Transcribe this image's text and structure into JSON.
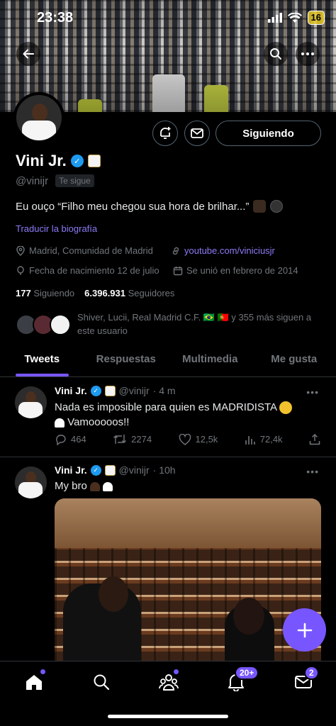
{
  "status_bar": {
    "time": "23:38",
    "battery": "16"
  },
  "profile": {
    "name": "Vini Jr.",
    "handle": "@vinijr",
    "follows_you": "Te sigue",
    "follow_button": "Siguiendo",
    "bio": "Eu ouço “Filho meu chegou sua hora de brilhar...”",
    "translate": "Traducir la biografía",
    "location": "Madrid, Comunidad de Madrid",
    "website": "youtube.com/viniciusjr",
    "birthday": "Fecha de nacimiento 12 de julio",
    "joined": "Se unió en febrero de 2014",
    "following_count": "177",
    "following_label": "Siguiendo",
    "followers_count": "6.396.931",
    "followers_label": "Seguidores",
    "followed_by": "Shiver, Lucii, Real Madrid C.F. 🇧🇷 🇵🇹 y 355 más siguen a este usuario"
  },
  "tabs": [
    "Tweets",
    "Respuestas",
    "Multimedia",
    "Me gusta"
  ],
  "tweets": [
    {
      "name": "Vini Jr.",
      "handle": "@vinijr",
      "time": "· 4 m",
      "text_line1": "Nada es imposible para quien es MADRIDISTA",
      "text_line2": "Vamooooos!!",
      "replies": "464",
      "retweets": "2274",
      "likes": "12,5k",
      "views": "72,4k"
    },
    {
      "name": "Vini Jr.",
      "handle": "@vinijr",
      "time": "· 10h",
      "text": "My bro"
    }
  ],
  "bottom_nav": {
    "notifications_badge": "20+",
    "messages_badge": "2"
  },
  "colors": {
    "accent": "#7856ff",
    "link": "#8b7cf6",
    "verified": "#1d9bf0",
    "muted": "#71767b"
  }
}
